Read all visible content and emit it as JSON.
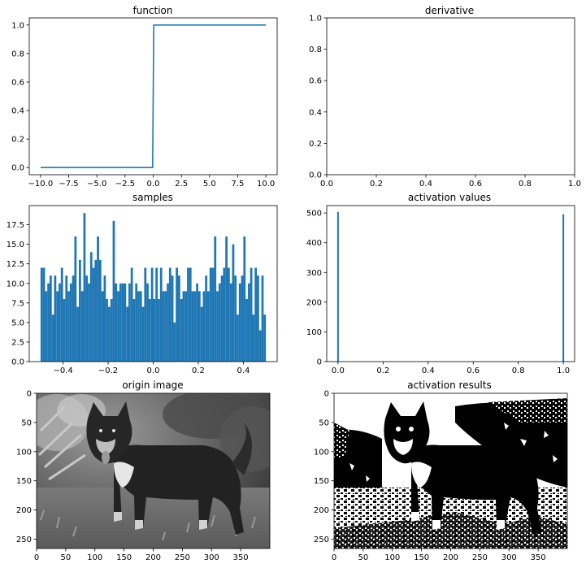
{
  "figure": {
    "accent": "#1f77b4"
  },
  "chart_data": [
    {
      "type": "line",
      "title": "function",
      "xlim": [
        -11,
        11
      ],
      "ylim": [
        -0.05,
        1.05
      ],
      "xticks": [
        -10.0,
        -7.5,
        -5.0,
        -2.5,
        0.0,
        2.5,
        5.0,
        7.5,
        10.0
      ],
      "xtick_labels": [
        "−10.0",
        "−7.5",
        "−5.0",
        "−2.5",
        "0.0",
        "2.5",
        "5.0",
        "7.5",
        "10.0"
      ],
      "yticks": [
        0.0,
        0.2,
        0.4,
        0.6,
        0.8,
        1.0
      ],
      "ytick_labels": [
        "0.0",
        "0.2",
        "0.4",
        "0.6",
        "0.8",
        "1.0"
      ],
      "series": [
        {
          "x": [
            -10,
            -0.05,
            0.05,
            10
          ],
          "y": [
            0,
            0,
            1,
            1
          ],
          "color": "#1f77b4"
        }
      ]
    },
    {
      "type": "line",
      "title": "derivative",
      "xlim": [
        0,
        1
      ],
      "ylim": [
        0,
        1
      ],
      "xticks": [
        0.0,
        0.2,
        0.4,
        0.6,
        0.8,
        1.0
      ],
      "xtick_labels": [
        "0.0",
        "0.2",
        "0.4",
        "0.6",
        "0.8",
        "1.0"
      ],
      "yticks": [
        0.0,
        0.2,
        0.4,
        0.6,
        0.8,
        1.0
      ],
      "ytick_labels": [
        "0.0",
        "0.2",
        "0.4",
        "0.6",
        "0.8",
        "1.0"
      ],
      "series": []
    },
    {
      "type": "bar",
      "title": "samples",
      "xlim": [
        -0.55,
        0.55
      ],
      "ylim": [
        0,
        19.95
      ],
      "bin_start": -0.5,
      "bin_width": 0.01,
      "color": "#1f77b4",
      "values": [
        12,
        12,
        9,
        10,
        11,
        6,
        11,
        9,
        10,
        12,
        8,
        11,
        9,
        10,
        11,
        16,
        7,
        13,
        9,
        19,
        11,
        10,
        14,
        12,
        13,
        16,
        13,
        9,
        11,
        8,
        7,
        8,
        18,
        10,
        9,
        10,
        10,
        10,
        7,
        10,
        12,
        8,
        10,
        9,
        9,
        7,
        12,
        10,
        8,
        12,
        8,
        12,
        8,
        12,
        9,
        9,
        10,
        12,
        11,
        5,
        12,
        11,
        8,
        9,
        9,
        12,
        12,
        9,
        9,
        10,
        9,
        7,
        9,
        11,
        9,
        12,
        12,
        16,
        9,
        10,
        11,
        12,
        16,
        12,
        10,
        15,
        11,
        6,
        10,
        11,
        16,
        8,
        10,
        12,
        6,
        12,
        11,
        4,
        11,
        6
      ],
      "xticks": [
        -0.4,
        -0.2,
        0.0,
        0.2,
        0.4
      ],
      "xtick_labels": [
        "−0.4",
        "−0.2",
        "0.0",
        "0.2",
        "0.4"
      ],
      "yticks": [
        0.0,
        2.5,
        5.0,
        7.5,
        10.0,
        12.5,
        15.0,
        17.5
      ],
      "ytick_labels": [
        "0.0",
        "2.5",
        "5.0",
        "7.5",
        "10.0",
        "12.5",
        "15.0",
        "17.5"
      ]
    },
    {
      "type": "bar",
      "title": "activation values",
      "xlim": [
        -0.05,
        1.05
      ],
      "ylim": [
        0,
        525
      ],
      "bars": [
        {
          "x": 0.0,
          "value": 504
        },
        {
          "x": 1.0,
          "value": 496
        }
      ],
      "bar_width": 0.005,
      "color": "#1f77b4",
      "xticks": [
        0.0,
        0.2,
        0.4,
        0.6,
        0.8,
        1.0
      ],
      "xtick_labels": [
        "0.0",
        "0.2",
        "0.4",
        "0.6",
        "0.8",
        "1.0"
      ],
      "yticks": [
        0,
        100,
        200,
        300,
        400,
        500
      ],
      "ytick_labels": [
        "0",
        "100",
        "200",
        "300",
        "400",
        "500"
      ]
    },
    {
      "type": "image",
      "title": "origin image",
      "colormap": "gray",
      "subject": "dog",
      "xlim": [
        0,
        400
      ],
      "ylim": [
        0,
        266
      ],
      "xticks": [
        0,
        50,
        100,
        150,
        200,
        250,
        300,
        350
      ],
      "xtick_labels": [
        "0",
        "50",
        "100",
        "150",
        "200",
        "250",
        "300",
        "350"
      ],
      "yticks": [
        0,
        50,
        100,
        150,
        200,
        250
      ],
      "ytick_labels": [
        "0",
        "50",
        "100",
        "150",
        "200",
        "250"
      ]
    },
    {
      "type": "image",
      "title": "activation results",
      "colormap": "binary",
      "subject": "dog",
      "xlim": [
        0,
        400
      ],
      "ylim": [
        0,
        266
      ],
      "xticks": [
        0,
        50,
        100,
        150,
        200,
        250,
        300,
        350
      ],
      "xtick_labels": [
        "0",
        "50",
        "100",
        "150",
        "200",
        "250",
        "300",
        "350"
      ],
      "yticks": [
        0,
        50,
        100,
        150,
        200,
        250
      ],
      "ytick_labels": [
        "0",
        "50",
        "100",
        "150",
        "200",
        "250"
      ]
    }
  ]
}
